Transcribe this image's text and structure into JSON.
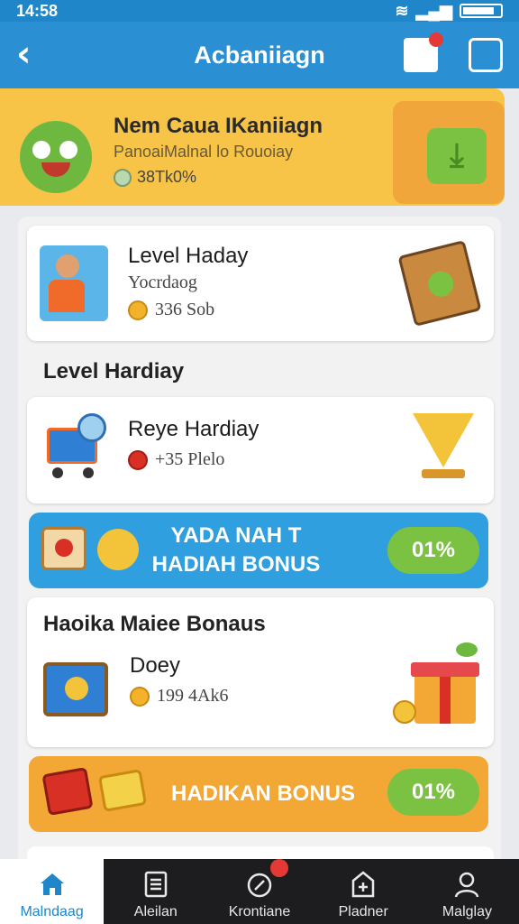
{
  "status_bar": {
    "time": "14:58"
  },
  "header": {
    "title": "Acbaniiagn",
    "back_icon": "chevron-left-icon",
    "doc_icon": "document-icon",
    "swap_icon": "swap-icon"
  },
  "banner": {
    "title": "Nem Caua IKaniiagn",
    "subtitle": "PanoaiMalnal lo Rouoiay",
    "value": "38Tk0%",
    "button_icon": "download-icon"
  },
  "card1": {
    "title": "Level Haday",
    "subtitle": "Yocrdaog",
    "value": "336 Sob"
  },
  "section1": {
    "title": "Level Hardiay"
  },
  "card2": {
    "title": "Reye Hardiay",
    "value": "+35 Plelo"
  },
  "bonus_bar": {
    "line1": "YADA NAH T",
    "line2": "HADIAH BONUS",
    "pill": "01%"
  },
  "section2": {
    "title": "Haoika Maiee Bonaus"
  },
  "card3": {
    "title": "Doey",
    "value": "199 4Ak6"
  },
  "bonus_bar2": {
    "label": "HADIKAN BONUS",
    "pill": "01%"
  },
  "nav": [
    {
      "label": "Malndaag",
      "icon": "home-icon",
      "active": true
    },
    {
      "label": "Aleilan",
      "icon": "list-icon",
      "active": false
    },
    {
      "label": "Krontiane",
      "icon": "compass-icon",
      "active": false,
      "badge": true
    },
    {
      "label": "Pladner",
      "icon": "plus-box-icon",
      "active": false
    },
    {
      "label": "Malglay",
      "icon": "profile-icon",
      "active": false
    }
  ],
  "colors": {
    "primary": "#2b8fd4",
    "banner": "#f7c447",
    "accent_green": "#7cc242",
    "bar_blue": "#2f9fe0",
    "bar_orange": "#f3a735"
  }
}
